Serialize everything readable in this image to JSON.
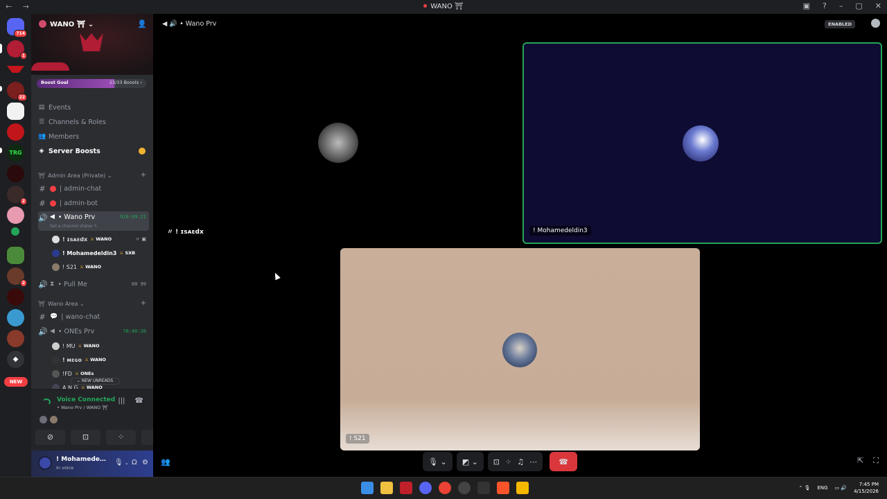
{
  "window": {
    "title": "WANO ⛩",
    "nav": "← →"
  },
  "titlebar_icons": [
    "▣",
    "?",
    "–",
    "▢",
    "✕"
  ],
  "rail": {
    "home_badge": "714",
    "badges": {
      "s1": "1",
      "s3": "22",
      "s9": "2",
      "s15": "2"
    },
    "new_label": "NEW"
  },
  "server": {
    "name": "WANO ⛩ ⌄",
    "boost_goal": "Boost Goal",
    "boost_count": "23/33 Boosts ›"
  },
  "menu": [
    {
      "icon": "▤",
      "label": "Events"
    },
    {
      "icon": "☰",
      "label": "Channels & Roles"
    },
    {
      "icon": "👥",
      "label": "Members"
    },
    {
      "icon": "◈",
      "label": "Server Boosts"
    }
  ],
  "categories": {
    "admin": "Admin Area (Private) ⌄",
    "wano": "Wano Area ⌄"
  },
  "channels": {
    "admin_chat": "| admin-chat",
    "admin_bot": "| admin-bot",
    "wano_prv": "• Wano Prv",
    "wano_prv_timer": "916:09:21",
    "wano_prv_status": "Set a channel status ✎",
    "pull_me": "• Pull Me",
    "pull_me_count": "00  99",
    "wano_chat": "| wano-chat",
    "ones_prv": "• ONEs Prv",
    "ones_prv_timer": "78:40:20"
  },
  "users": {
    "u1": "! ɪsᴀᴇdx",
    "u1_tag": "WANO",
    "u2": "! Mohamedeldin3",
    "u2_tag": "SXB",
    "u3": "! S21",
    "u3_tag": "WANO",
    "u4": "! MU",
    "u4_tag": "WANO",
    "u5": "! ᴍᴇɢᴏ",
    "u5_tag": "WANO",
    "u6": "!FD",
    "u6_tag": "ONEs",
    "u7": "A N G",
    "u7_tag": "WANO"
  },
  "new_unreads": "⌄ NEW UNREADS",
  "voice": {
    "status": "Voice Connected",
    "location": "• Wano Prv / WANO ⛩"
  },
  "me": {
    "name": "! Mohamedeldin3",
    "status": "In voice"
  },
  "call": {
    "channel": "• Wano Prv",
    "enabled": "ENABLED",
    "tile1_label": "〃 ! ɪsᴀᴇdx",
    "tile2_label": "! Mohamedeldin3",
    "tile3_label": "! S21"
  },
  "controls": {
    "mic": "🎙 ⌄",
    "cam": "◩ ⌄",
    "share": "⊡",
    "activity": "⁘",
    "soundboard": "♫",
    "more": "⋯",
    "hangup": "☎"
  },
  "taskbar": {
    "lang": "ENG",
    "time": "7:45 PM",
    "date": "4/15/2026",
    "tray": "⌃  🎙"
  },
  "colors": {
    "accent": "#23a559",
    "danger": "#da373c",
    "boost": "#9b4db5"
  }
}
